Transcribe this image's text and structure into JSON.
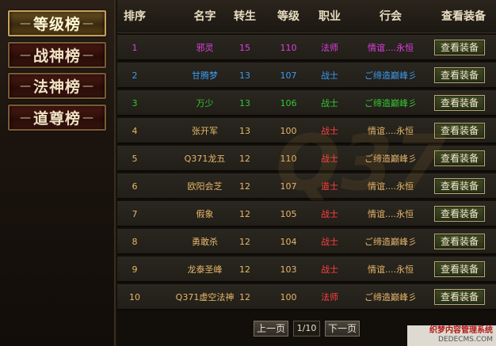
{
  "sidebar": {
    "items": [
      {
        "label": "等级榜",
        "active": true
      },
      {
        "label": "战神榜",
        "active": false
      },
      {
        "label": "法神榜",
        "active": false
      },
      {
        "label": "道尊榜",
        "active": false
      }
    ],
    "deco_left": "—",
    "deco_right": "—"
  },
  "table": {
    "headers": {
      "rank": "排序",
      "name": "名字",
      "rebirth": "转生",
      "level": "等级",
      "class": "职业",
      "guild": "行会",
      "equip": "查看装备"
    },
    "button_label": "查看装备",
    "rows": [
      {
        "rank": "1",
        "name": "邪灵",
        "rebirth": "15",
        "level": "110",
        "class": "法师",
        "guild": "情谊....永恒",
        "color": "#e040e0"
      },
      {
        "rank": "2",
        "name": "甘腾梦",
        "rebirth": "13",
        "level": "107",
        "class": "战士",
        "guild": "ご缔造巅峰彡",
        "color": "#3a9cf0"
      },
      {
        "rank": "3",
        "name": "万少",
        "rebirth": "13",
        "level": "106",
        "class": "战士",
        "guild": "ご缔造巅峰彡",
        "color": "#34c834"
      },
      {
        "rank": "4",
        "name": "张开军",
        "rebirth": "13",
        "level": "100",
        "class": "战士",
        "guild": "情谊....永恒",
        "color": "#e6b86a"
      },
      {
        "rank": "5",
        "name": "Q371龙五",
        "rebirth": "12",
        "level": "110",
        "class": "战士",
        "guild": "ご缔造巅峰彡",
        "color": "#e6b86a"
      },
      {
        "rank": "6",
        "name": "欧阳会芝",
        "rebirth": "12",
        "level": "107",
        "class": "道士",
        "guild": "情谊....永恒",
        "color": "#e6b86a"
      },
      {
        "rank": "7",
        "name": "假象",
        "rebirth": "12",
        "level": "105",
        "class": "战士",
        "guild": "情谊....永恒",
        "color": "#e6b86a"
      },
      {
        "rank": "8",
        "name": "勇敢杀",
        "rebirth": "12",
        "level": "104",
        "class": "战士",
        "guild": "ご缔造巅峰彡",
        "color": "#e6b86a"
      },
      {
        "rank": "9",
        "name": "龙泰圣峰",
        "rebirth": "12",
        "level": "103",
        "class": "战士",
        "guild": "情谊....永恒",
        "color": "#e6b86a"
      },
      {
        "rank": "10",
        "name": "Q371虚空法神",
        "rebirth": "12",
        "level": "100",
        "class": "法师",
        "guild": "ご缔造巅峰彡",
        "color": "#e6b86a"
      }
    ]
  },
  "pager": {
    "prev": "上一页",
    "info": "1/10",
    "next": "下一页"
  },
  "watermark": {
    "center": "Q37",
    "corner_line1": "织梦内容管理系统",
    "corner_line2": "DEDECMS.COM"
  },
  "colors": {
    "class_red": "#ff4040",
    "guild_default": "#e6b86a"
  }
}
